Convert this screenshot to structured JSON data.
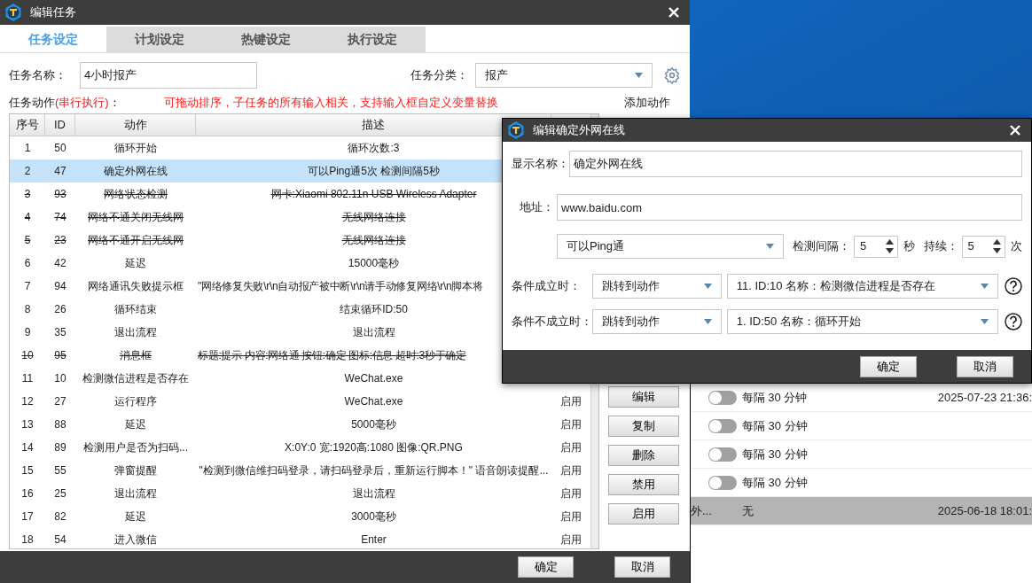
{
  "main_window": {
    "title": "编辑任务",
    "tabs": [
      {
        "label": "任务设定",
        "selected": true
      },
      {
        "label": "计划设定",
        "selected": false
      },
      {
        "label": "热键设定",
        "selected": false
      },
      {
        "label": "执行设定",
        "selected": false
      }
    ],
    "task_name": {
      "label": "任务名称：",
      "value": "4小时报产"
    },
    "category": {
      "label": "任务分类：",
      "value": "报产"
    },
    "actions_label": {
      "text": "任务动作",
      "accent": "(串行执行)",
      "colon": "："
    },
    "hint": "可拖动排序，子任务的所有输入相关，支持输入框自定义变量替换",
    "table": {
      "columns": [
        "序号",
        "ID",
        "动作",
        "描述"
      ],
      "rows": [
        {
          "kind": "centered",
          "no": "1",
          "id": "50",
          "action": "循环开始",
          "desc": "循环次数:3",
          "disabled": false,
          "selected": false
        },
        {
          "kind": "centered",
          "no": "2",
          "id": "47",
          "action": "确定外网在线",
          "desc": "可以Ping通5次 检测间隔5秒",
          "disabled": false,
          "selected": true
        },
        {
          "kind": "centered",
          "no": "3",
          "id": "93",
          "action": "网络状态检测",
          "desc": "网卡:Xiaomi 802.11n USB Wireless Adapter",
          "disabled": true,
          "selected": false
        },
        {
          "kind": "centered",
          "no": "4",
          "id": "74",
          "action": "网络不通关闭无线网",
          "desc": "无线网络连接",
          "disabled": true,
          "selected": false
        },
        {
          "kind": "centered",
          "no": "5",
          "id": "23",
          "action": "网络不通开启无线网",
          "desc": "无线网络连接",
          "disabled": true,
          "selected": false
        },
        {
          "kind": "centered",
          "no": "6",
          "id": "42",
          "action": "延迟",
          "desc": "15000毫秒",
          "disabled": false,
          "selected": false
        },
        {
          "kind": "clipped",
          "no": "7",
          "id": "94",
          "action": "网络通讯失败提示框",
          "desc": "\"网络修复失败\\r\\n自动报产被中断\\r\\n请手动修复网络\\r\\n脚本将",
          "disabled": false,
          "selected": false
        },
        {
          "kind": "centered",
          "no": "8",
          "id": "26",
          "action": "循环结束",
          "desc": "结束循环ID:50",
          "disabled": false,
          "selected": false
        },
        {
          "kind": "centered",
          "no": "9",
          "id": "35",
          "action": "退出流程",
          "desc": "退出流程",
          "disabled": false,
          "selected": false
        },
        {
          "kind": "clipped",
          "no": "10",
          "id": "95",
          "action": "消息框",
          "desc": "标题:提示  内容:网络通  按钮:确定  图标:信息  超时:3秒于确定",
          "disabled": true,
          "selected": false
        },
        {
          "kind": "centered",
          "no": "11",
          "id": "10",
          "action": "检测微信进程是否存在",
          "desc": "WeChat.exe",
          "disabled": false,
          "selected": false
        },
        {
          "kind": "centered",
          "no": "12",
          "id": "27",
          "action": "运行程序",
          "desc": "WeChat.exe",
          "status": "启用",
          "disabled": false,
          "selected": false
        },
        {
          "kind": "centered",
          "no": "13",
          "id": "88",
          "action": "延迟",
          "desc": "5000毫秒",
          "status": "启用",
          "disabled": false,
          "selected": false
        },
        {
          "kind": "centered",
          "no": "14",
          "id": "89",
          "action": "检测用户是否为扫码...",
          "desc": "X:0Y:0 宽:1920高:1080 图像:QR.PNG",
          "status": "启用",
          "disabled": false,
          "selected": false
        },
        {
          "kind": "centered",
          "no": "15",
          "id": "55",
          "action": "弹窗提醒",
          "desc": "\"检测到微信维扫码登录，请扫码登录后，重新运行脚本！\" 语音朗读提醒...",
          "status": "启用",
          "disabled": false,
          "selected": false
        },
        {
          "kind": "centered",
          "no": "16",
          "id": "25",
          "action": "退出流程",
          "desc": "退出流程",
          "status": "启用",
          "disabled": false,
          "selected": false
        },
        {
          "kind": "centered",
          "no": "17",
          "id": "82",
          "action": "延迟",
          "desc": "3000毫秒",
          "status": "启用",
          "disabled": false,
          "selected": false
        },
        {
          "kind": "centered",
          "no": "18",
          "id": "54",
          "action": "进入微信",
          "desc": "Enter",
          "status": "启用",
          "disabled": false,
          "selected": false
        }
      ]
    },
    "side_title": "添加动作",
    "side_buttons": [
      "编辑",
      "复制",
      "删除",
      "禁用",
      "启用"
    ],
    "buttons": [
      "确定",
      "取消"
    ]
  },
  "background_list": {
    "rows": [
      {
        "on": false,
        "interval": "每隔 30 分钟",
        "time": "2025-07-23 21:36:",
        "selected": false
      },
      {
        "on": false,
        "interval": "每隔 30 分钟",
        "selected": false
      },
      {
        "on": false,
        "interval": "每隔 30 分钟",
        "selected": false
      },
      {
        "on": false,
        "interval": "每隔 30 分钟",
        "selected": false
      },
      {
        "name": "外...",
        "interval": "无",
        "time": "2025-06-18 18:01:",
        "selected": true
      }
    ]
  },
  "dialog": {
    "title": "编辑确定外网在线",
    "display_name": {
      "label": "显示名称：",
      "value": "确定外网在线"
    },
    "address": {
      "label": "地址：",
      "value": "www.baidu.com"
    },
    "mode": {
      "value": "可以Ping通"
    },
    "interval": {
      "label": "检测间隔：",
      "value": "5",
      "unit": "秒"
    },
    "duration": {
      "label": "持续：",
      "value": "5",
      "unit": "次"
    },
    "conditions": [
      {
        "label": "条件成立时：",
        "action": "跳转到动作",
        "target": "11. ID:10 名称：检测微信进程是否存在"
      },
      {
        "label": "条件不成立时：",
        "action": "跳转到动作",
        "target": "1. ID:50 名称：循环开始"
      }
    ],
    "buttons": [
      "确定",
      "取消"
    ]
  }
}
